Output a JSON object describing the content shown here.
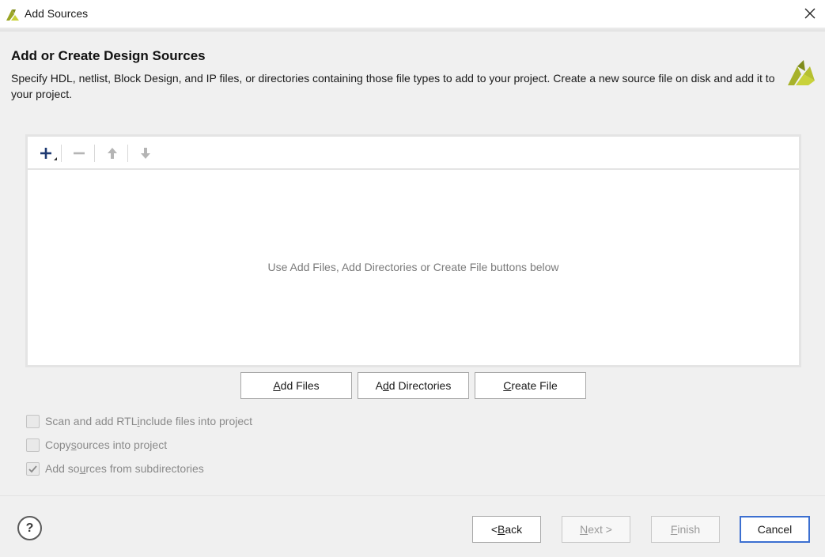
{
  "window": {
    "title": "Add Sources"
  },
  "header": {
    "heading": "Add or Create Design Sources",
    "description": "Specify HDL, netlist, Block Design, and IP files, or directories containing those file types to add to your project. Create a new source file on disk and add it to your project."
  },
  "toolbar": {
    "icons": [
      "add-icon",
      "remove-icon",
      "move-up-icon",
      "move-down-icon"
    ]
  },
  "file_table": {
    "empty_message": "Use Add Files, Add Directories or Create File buttons below"
  },
  "actions": {
    "add_files": {
      "pre": "",
      "ul": "A",
      "post": "dd Files"
    },
    "add_directories": {
      "pre": "A",
      "ul": "d",
      "post": "d Directories"
    },
    "create_file": {
      "pre": "",
      "ul": "C",
      "post": "reate File"
    }
  },
  "options": {
    "scan_rtl": {
      "pre": "Scan and add RTL ",
      "ul": "i",
      "post": "nclude files into project",
      "checked": false,
      "enabled": false
    },
    "copy_sources": {
      "pre": "Copy ",
      "ul": "s",
      "post": "ources into project",
      "checked": false,
      "enabled": false
    },
    "add_subdirs": {
      "pre": "Add so",
      "ul": "u",
      "post": "rces from subdirectories",
      "checked": true,
      "enabled": false
    }
  },
  "footer": {
    "help": "?",
    "back": {
      "pre": "< ",
      "ul": "B",
      "post": "ack",
      "enabled": true
    },
    "next": {
      "pre": "",
      "ul": "N",
      "post": "ext >",
      "enabled": false
    },
    "finish": {
      "pre": "",
      "ul": "F",
      "post": "inish",
      "enabled": false
    },
    "cancel": {
      "label": "Cancel",
      "enabled": true
    }
  },
  "colors": {
    "brand_light": "#c9d23a",
    "brand_dark": "#7f8c1c",
    "accent_border": "#3c6fd0"
  }
}
